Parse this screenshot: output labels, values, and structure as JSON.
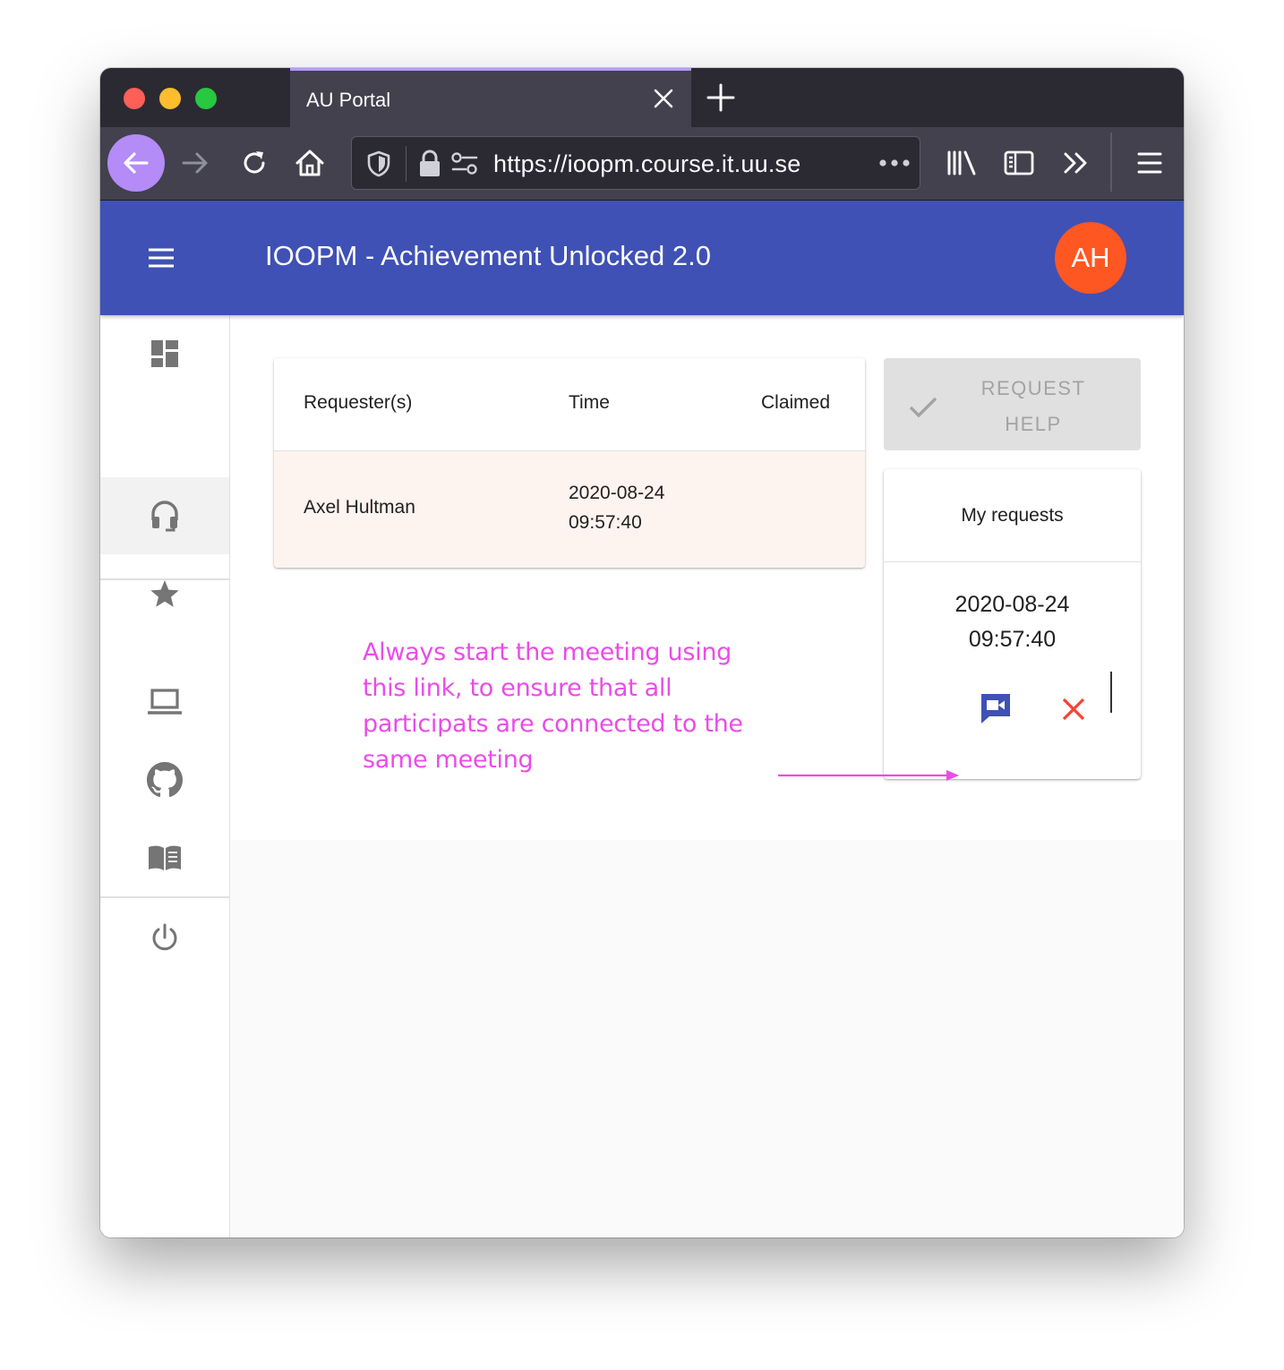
{
  "browser": {
    "tab_title": "AU Portal",
    "url": "https://ioopm.course.it.uu.se",
    "accent_color": "#b48bf7"
  },
  "app": {
    "title": "IOOPM - Achievement Unlocked 2.0",
    "avatar_initials": "AH",
    "bar_color": "#3f51b5",
    "avatar_color": "#ff5722"
  },
  "sidebar": {
    "items": [
      {
        "icon": "dashboard-icon",
        "active": false
      },
      {
        "icon": "headset-icon",
        "active": true
      },
      {
        "icon": "star-icon",
        "active": false
      },
      {
        "icon": "laptop-icon",
        "active": false
      },
      {
        "icon": "github-icon",
        "active": false
      },
      {
        "icon": "book-icon",
        "active": false
      },
      {
        "icon": "power-icon",
        "active": false
      }
    ]
  },
  "queue_table": {
    "columns": [
      "Requester(s)",
      "Time",
      "Claimed"
    ],
    "rows": [
      {
        "requester": "Axel Hultman",
        "date": "2020-08-24",
        "time": "09:57:40",
        "claimed": ""
      }
    ]
  },
  "request_help": {
    "label_line1": "REQUEST",
    "label_line2": "HELP",
    "icon": "check-icon"
  },
  "my_requests": {
    "title": "My requests",
    "date": "2020-08-24",
    "time": "09:57:40",
    "meeting_icon": "video-meeting-icon",
    "cancel_icon": "close-icon"
  },
  "annotation": {
    "text": "Always start the meeting using this link, to ensure that all participats are connected to the same meeting",
    "color": "#ea4ce8"
  }
}
